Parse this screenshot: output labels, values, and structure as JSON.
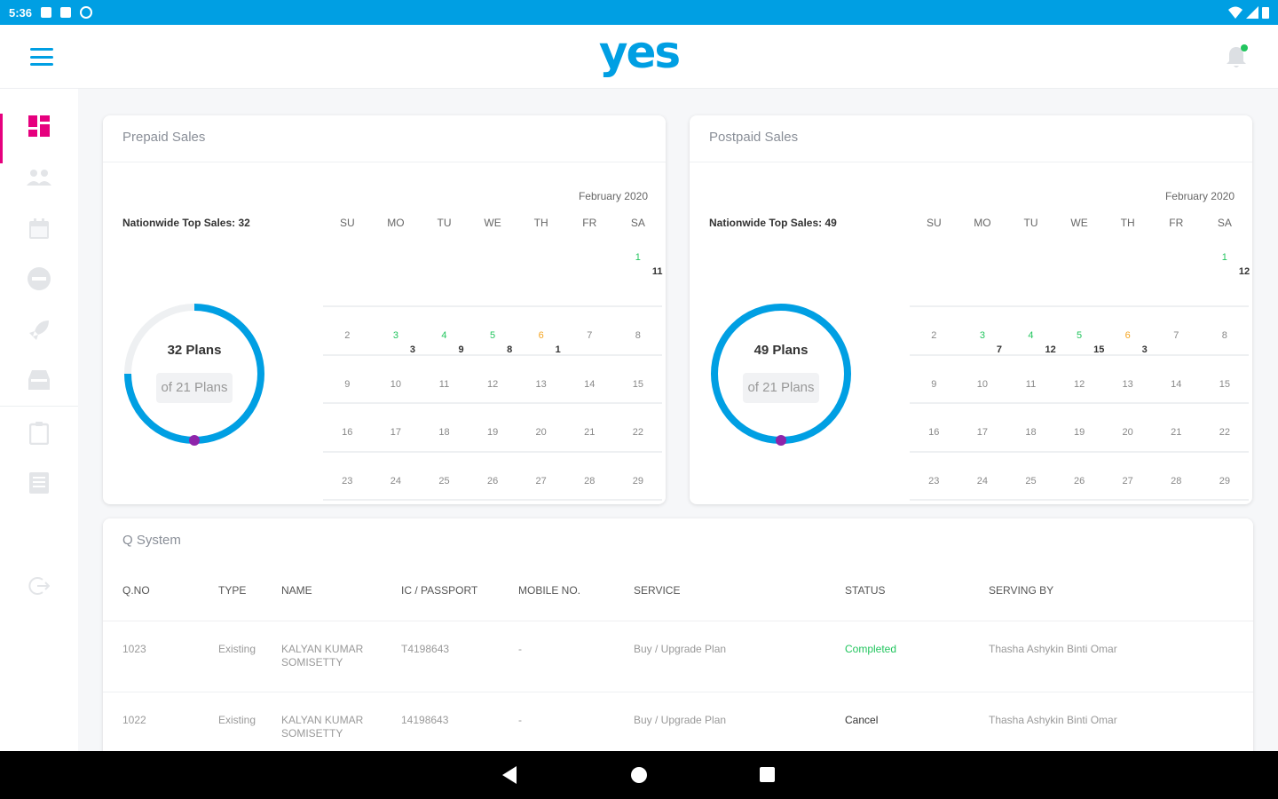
{
  "status_bar": {
    "time": "5:36"
  },
  "app": {
    "logo": "yes",
    "accent": "#009fe3",
    "pink": "#e6007e"
  },
  "sidebar": {
    "items": [
      {
        "name": "dashboard-icon",
        "active": true
      },
      {
        "name": "users-icon"
      },
      {
        "name": "calendar-icon"
      },
      {
        "name": "sim-icon"
      },
      {
        "name": "rocket-icon"
      },
      {
        "name": "inbox-icon"
      },
      {
        "name": "clipboard-icon"
      },
      {
        "name": "document-icon"
      },
      {
        "name": "logout-icon"
      }
    ]
  },
  "prepaid": {
    "title": "Prepaid Sales",
    "top_sales": "Nationwide Top Sales: 32",
    "plans": "32 Plans",
    "of_plans": "of 21 Plans",
    "month": "February 2020"
  },
  "postpaid": {
    "title": "Postpaid Sales",
    "top_sales": "Nationwide Top Sales: 49",
    "plans": "49 Plans",
    "of_plans": "of 21 Plans",
    "month": "February 2020"
  },
  "calendar": {
    "weekdays": [
      "SU",
      "MO",
      "TU",
      "WE",
      "TH",
      "FR",
      "SA"
    ]
  },
  "qsystem": {
    "title": "Q System",
    "headers": [
      "Q.NO",
      "TYPE",
      "NAME",
      "IC / PASSPORT",
      "MOBILE NO.",
      "SERVICE",
      "STATUS",
      "SERVING BY"
    ],
    "rows": [
      {
        "qno": "1023",
        "type": "Existing",
        "name": "KALYAN KUMAR SOMISETTY",
        "ic": "T4198643",
        "mobile": "-",
        "service": "Buy / Upgrade Plan",
        "status": "Completed",
        "serving": "Thasha Ashykin Binti Omar"
      },
      {
        "qno": "1022",
        "type": "Existing",
        "name": "KALYAN KUMAR SOMISETTY",
        "ic": "14198643",
        "mobile": "-",
        "service": "Buy / Upgrade Plan",
        "status": "Cancel",
        "serving": "Thasha Ashykin Binti Omar"
      }
    ]
  }
}
